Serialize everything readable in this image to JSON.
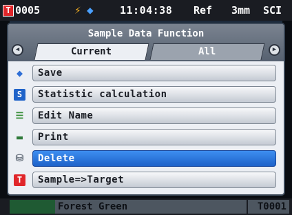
{
  "statusbar": {
    "sample_icon": "T",
    "sample_number": "0005",
    "battery_icon": "bolt-icon",
    "tag_icon": "tag-icon",
    "time": "11:04:38",
    "mode": "Ref",
    "aperture": "3mm",
    "specular": "SCI"
  },
  "dialog": {
    "title": "Sample Data Function",
    "tabs": [
      {
        "label": "Current",
        "active": true
      },
      {
        "label": "All",
        "active": false
      }
    ],
    "menu": [
      {
        "label": "Save",
        "icon": "save-tag-icon"
      },
      {
        "label": "Statistic calculation",
        "icon": "statistic-icon"
      },
      {
        "label": "Edit Name",
        "icon": "edit-name-icon"
      },
      {
        "label": "Print",
        "icon": "printer-icon"
      },
      {
        "label": "Delete",
        "icon": "trash-icon",
        "selected": true
      },
      {
        "label": "Sample=>Target",
        "icon": "target-icon"
      }
    ]
  },
  "bottombar": {
    "sample_name": "Forest Green",
    "target": "T0001"
  },
  "colors": {
    "selected": "#2c78e0",
    "swatch": "#1f5a33",
    "accent_red": "#e0262a"
  }
}
